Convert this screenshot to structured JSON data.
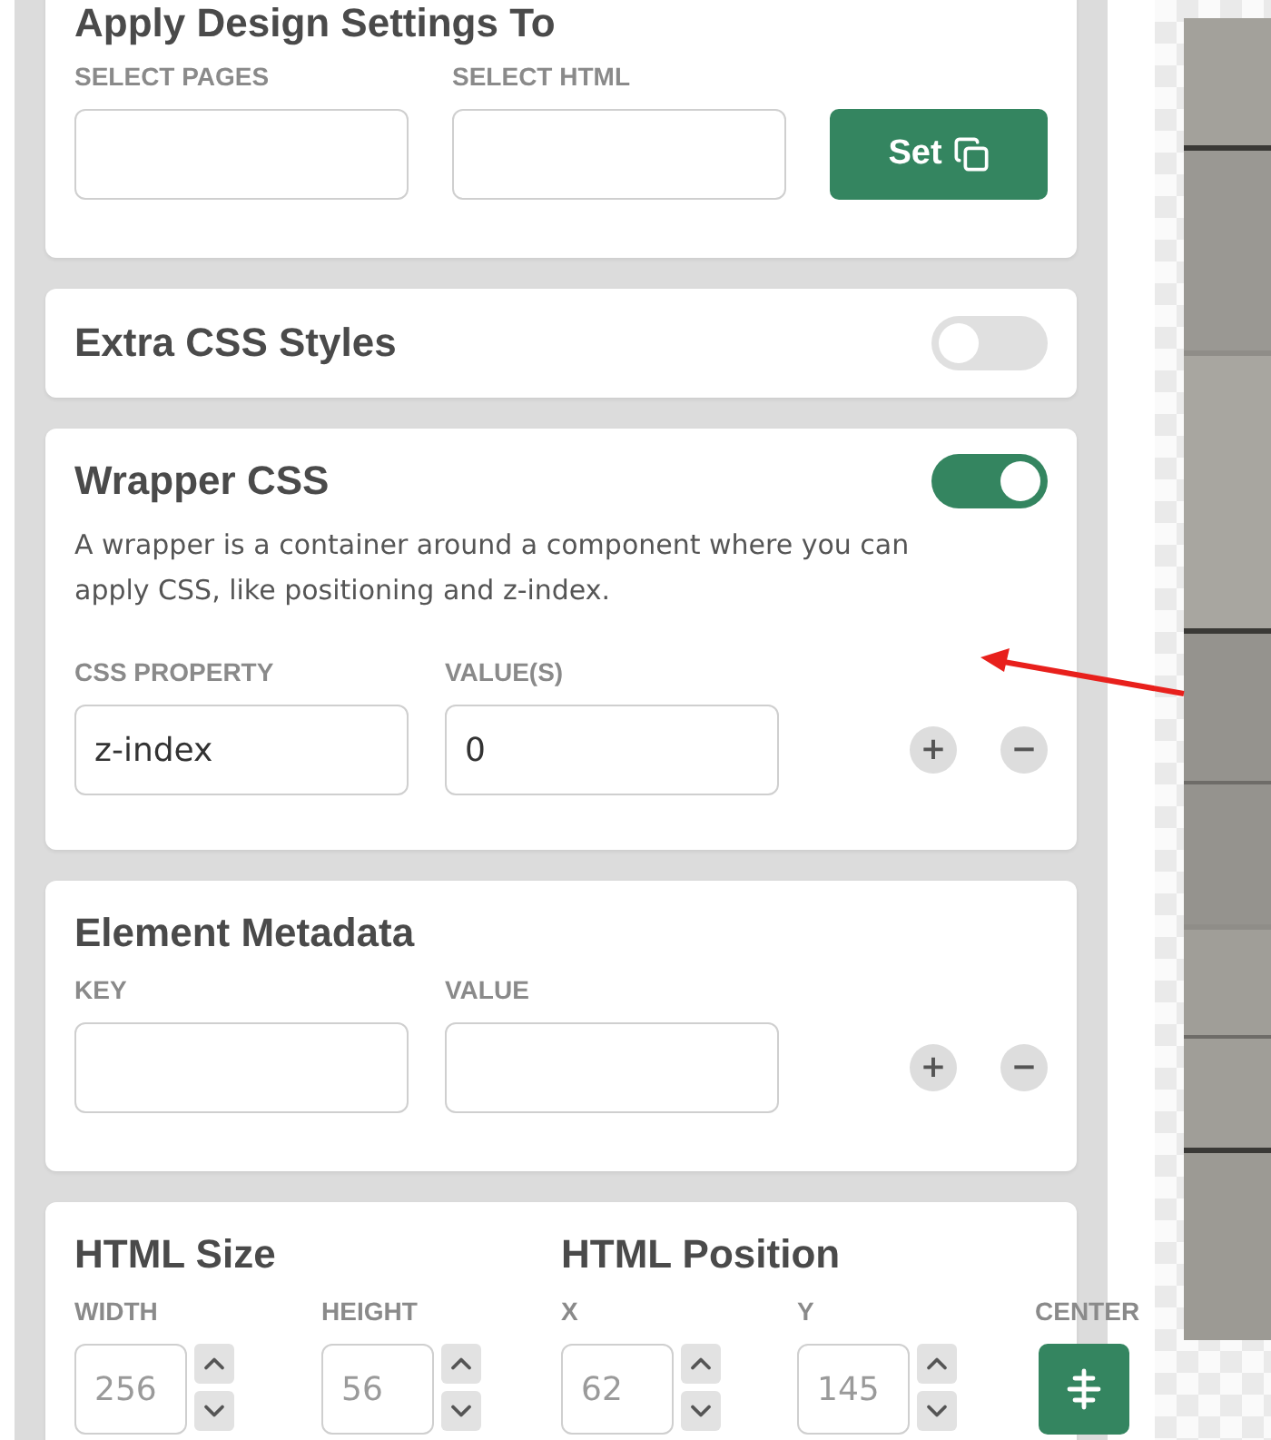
{
  "apply_design": {
    "title": "Apply Design Settings To",
    "fields": [
      {
        "label": "SELECT PAGES"
      },
      {
        "label": "SELECT HTML"
      }
    ],
    "button": "Set"
  },
  "extra_css": {
    "title": "Extra CSS Styles",
    "on": false
  },
  "wrapper_css": {
    "title": "Wrapper CSS",
    "on": true,
    "description": "A wrapper is a container around a component where you can apply CSS, like positioning and z-index.",
    "columns": [
      "CSS PROPERTY",
      "VALUE(S)"
    ],
    "rows": [
      {
        "property": "z-index",
        "value": "0"
      }
    ],
    "add": "+",
    "remove": "−"
  },
  "metadata": {
    "title": "Element Metadata",
    "columns": [
      "KEY",
      "VALUE"
    ],
    "add": "+",
    "remove": "−"
  },
  "size": {
    "title": "HTML Size",
    "fields": [
      {
        "label": "WIDTH",
        "value": "256",
        "disabled": true
      },
      {
        "label": "HEIGHT",
        "value": "56",
        "disabled": true
      }
    ]
  },
  "position": {
    "title": "HTML Position",
    "fields": [
      {
        "label": "X",
        "value": "62",
        "disabled": true
      },
      {
        "label": "Y",
        "value": "145",
        "disabled": true
      }
    ],
    "center_label": "CENTER"
  }
}
